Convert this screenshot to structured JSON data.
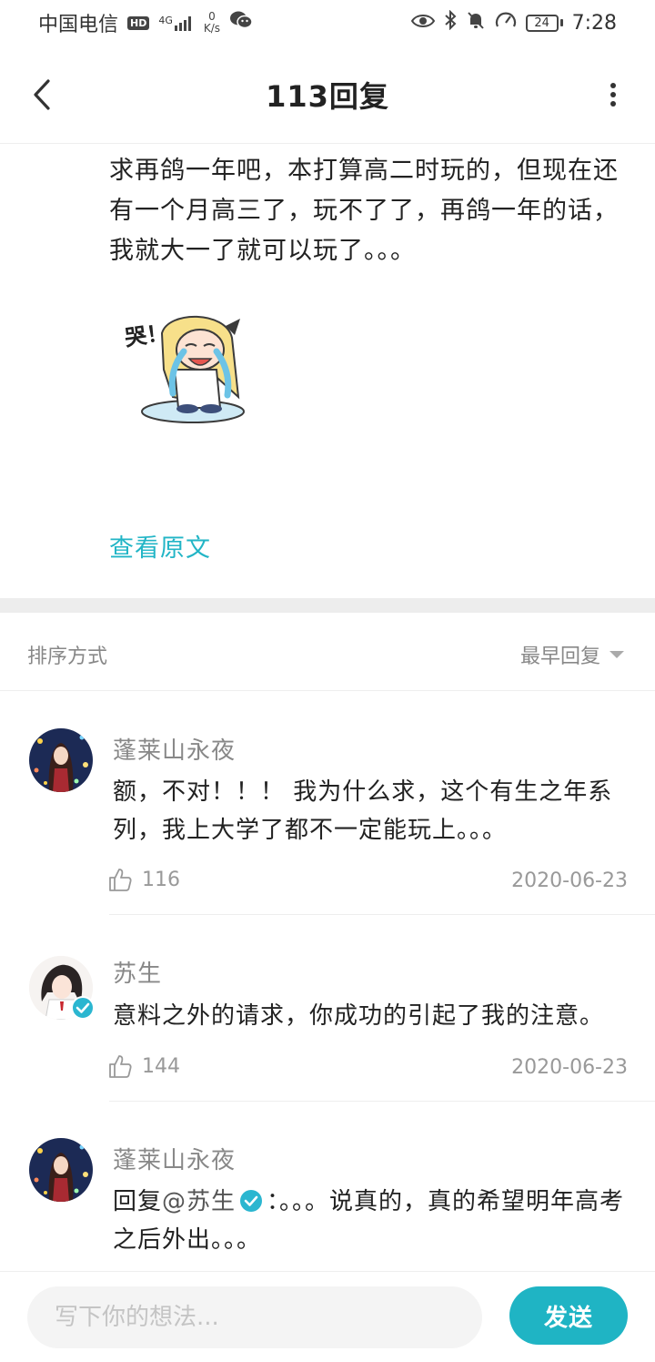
{
  "status_bar": {
    "carrier": "中国电信",
    "hd": "HD",
    "network": "4G",
    "speed_value": "0",
    "speed_unit": "K/s",
    "battery": "24",
    "time": "7:28"
  },
  "header": {
    "title": "113回复"
  },
  "post": {
    "text": "求再鸽一年吧，本打算高二时玩的，但现在还有一个月高三了，玩不了了，再鸽一年的话，我就大一了就可以玩了。。。",
    "sticker_caption": "哭！",
    "view_original": "查看原文"
  },
  "sort": {
    "label": "排序方式",
    "value": "最早回复"
  },
  "comments": [
    {
      "username": "蓬莱山永夜",
      "text": "额，不对！！！ 我为什么求，这个有生之年系列，我上大学了都不一定能玩上。。。",
      "likes": "116",
      "date": "2020-06-23"
    },
    {
      "username": "苏生",
      "text": "意料之外的请求，你成功的引起了我的注意。",
      "likes": "144",
      "date": "2020-06-23"
    },
    {
      "username": "蓬莱山永夜",
      "reply_prefix": "回复",
      "mention": "@苏生",
      "text": "：。。。说真的，真的希望明年高考之后外出。。。"
    }
  ],
  "composer": {
    "placeholder": "写下你的想法...",
    "send_label": "发送"
  },
  "colors": {
    "accent": "#1fb4c4",
    "link": "#22b5c6",
    "verified": "#2bb6d0"
  },
  "icons": {
    "back": "chevron-left-icon",
    "more": "more-vertical-icon",
    "like": "thumbs-up-icon",
    "verified": "verified-badge-icon",
    "sort_caret": "caret-down-icon"
  }
}
